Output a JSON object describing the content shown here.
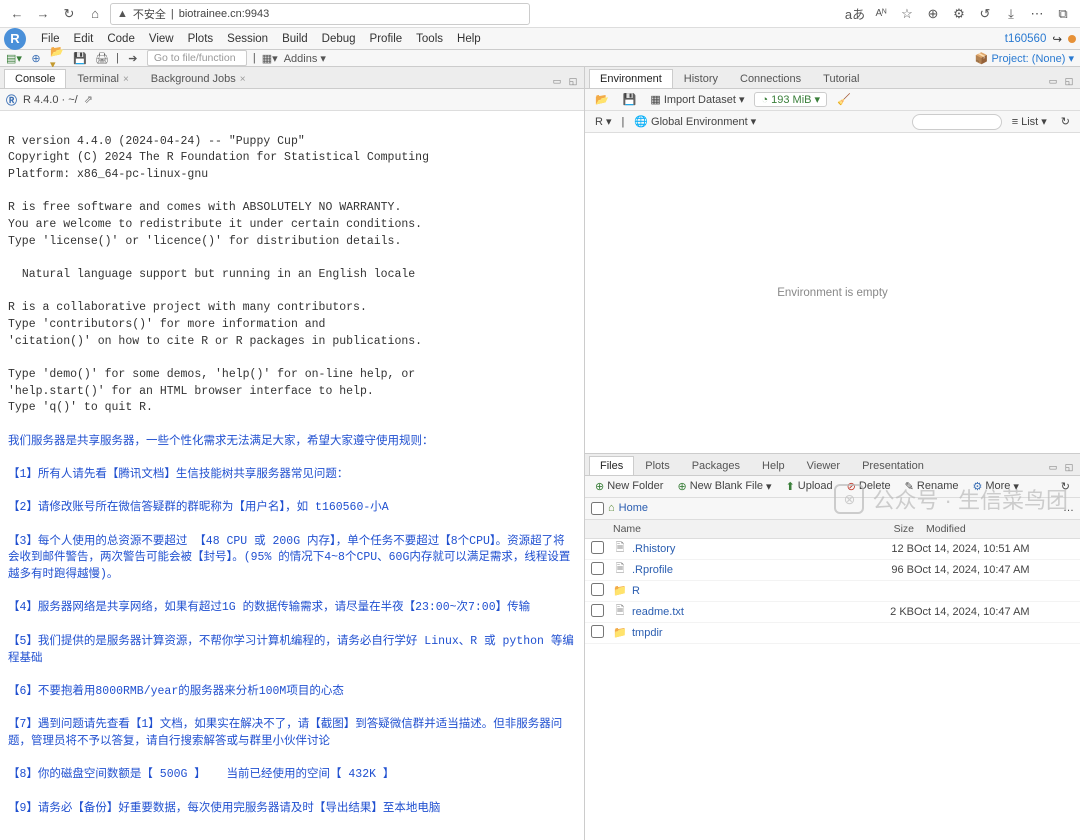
{
  "browser": {
    "insecure_label": "不安全",
    "url": "biotrainee.cn:9943"
  },
  "menubar": {
    "items": [
      "File",
      "Edit",
      "Code",
      "View",
      "Plots",
      "Session",
      "Build",
      "Debug",
      "Profile",
      "Tools",
      "Help"
    ],
    "user_id": "t160560"
  },
  "toolbar": {
    "goto_placeholder": "Go to file/function",
    "addins_label": "Addins",
    "project_label": "Project: (None)"
  },
  "left": {
    "tabs": [
      "Console",
      "Terminal",
      "Background Jobs"
    ],
    "active": 0,
    "console_sub": "R 4.4.0 · ~/",
    "console_text_gray": "R version 4.4.0 (2024-04-24) -- \"Puppy Cup\"\nCopyright (C) 2024 The R Foundation for Statistical Computing\nPlatform: x86_64-pc-linux-gnu\n\nR is free software and comes with ABSOLUTELY NO WARRANTY.\nYou are welcome to redistribute it under certain conditions.\nType 'license()' or 'licence()' for distribution details.\n\n  Natural language support but running in an English locale\n\nR is a collaborative project with many contributors.\nType 'contributors()' for more information and\n'citation()' on how to cite R or R packages in publications.\n\nType 'demo()' for some demos, 'help()' for on-line help, or\n'help.start()' for an HTML browser interface to help.\nType 'q()' to quit R.\n",
    "console_text_blue": "我们服务器是共享服务器，一些个性化需求无法满足大家，希望大家遵守使用规则：\n\n【1】所有人请先看【腾讯文档】生信技能树共享服务器常见问题：\n\n【2】请修改账号所在微信答疑群的群昵称为【用户名】，如 t160560-小A\n\n【3】每个人使用的总资源不要超过 【48 CPU 或 200G 内存】，单个任务不要超过【8个CPU】。资源超了将会收到邮件警告，两次警告可能会被【封号】。(95% 的情况下4~8个CPU、60G内存就可以满足需求，线程设置越多有时跑得越慢)。\n\n【4】服务器网络是共享网络，如果有超过1G 的数据传输需求，请尽量在半夜【23:00~次7:00】传输\n\n【5】我们提供的是服务器计算资源，不帮你学习计算机编程的，请务必自行学好 Linux、R 或 python 等编程基础\n\n【6】不要抱着用8000RMB/year的服务器来分析100M项目的心态\n\n【7】遇到问题请先查看【1】文档，如果实在解决不了，请【截图】到答疑微信群并适当描述。但非服务器问题，管理员将不予以答复，请自行搜索解答或与群里小伙伴讨论\n\n【8】你的磁盘空间数额是【 500G 】   当前已经使用的空间【 432K 】\n\n【9】请务必【备份】好重要数据，每次使用完服务器请及时【导出结果】至本地电脑"
  },
  "env": {
    "tabs": [
      "Environment",
      "History",
      "Connections",
      "Tutorial"
    ],
    "active": 0,
    "import_label": "Import Dataset",
    "mem_label": "193 MiB",
    "scope_label_left": "R",
    "scope_label_right": "Global Environment",
    "list_label": "List",
    "empty_text": "Environment is empty"
  },
  "files": {
    "tabs": [
      "Files",
      "Plots",
      "Packages",
      "Help",
      "Viewer",
      "Presentation"
    ],
    "active": 0,
    "btn_new_folder": "New Folder",
    "btn_new_file": "New Blank File",
    "btn_upload": "Upload",
    "btn_delete": "Delete",
    "btn_rename": "Rename",
    "btn_more": "More",
    "breadcrumb_home": "Home",
    "th_name": "Name",
    "th_size": "Size",
    "th_modified": "Modified",
    "rows": [
      {
        "icon": "file",
        "name": ".Rhistory",
        "size": "12 B",
        "mod": "Oct 14, 2024, 10:51 AM"
      },
      {
        "icon": "file",
        "name": ".Rprofile",
        "size": "96 B",
        "mod": "Oct 14, 2024, 10:47 AM"
      },
      {
        "icon": "folder",
        "name": "R",
        "size": "",
        "mod": ""
      },
      {
        "icon": "file",
        "name": "readme.txt",
        "size": "2 KB",
        "mod": "Oct 14, 2024, 10:47 AM"
      },
      {
        "icon": "folder",
        "name": "tmpdir",
        "size": "",
        "mod": ""
      }
    ]
  },
  "watermark": "公众号 · 生信菜鸟团"
}
